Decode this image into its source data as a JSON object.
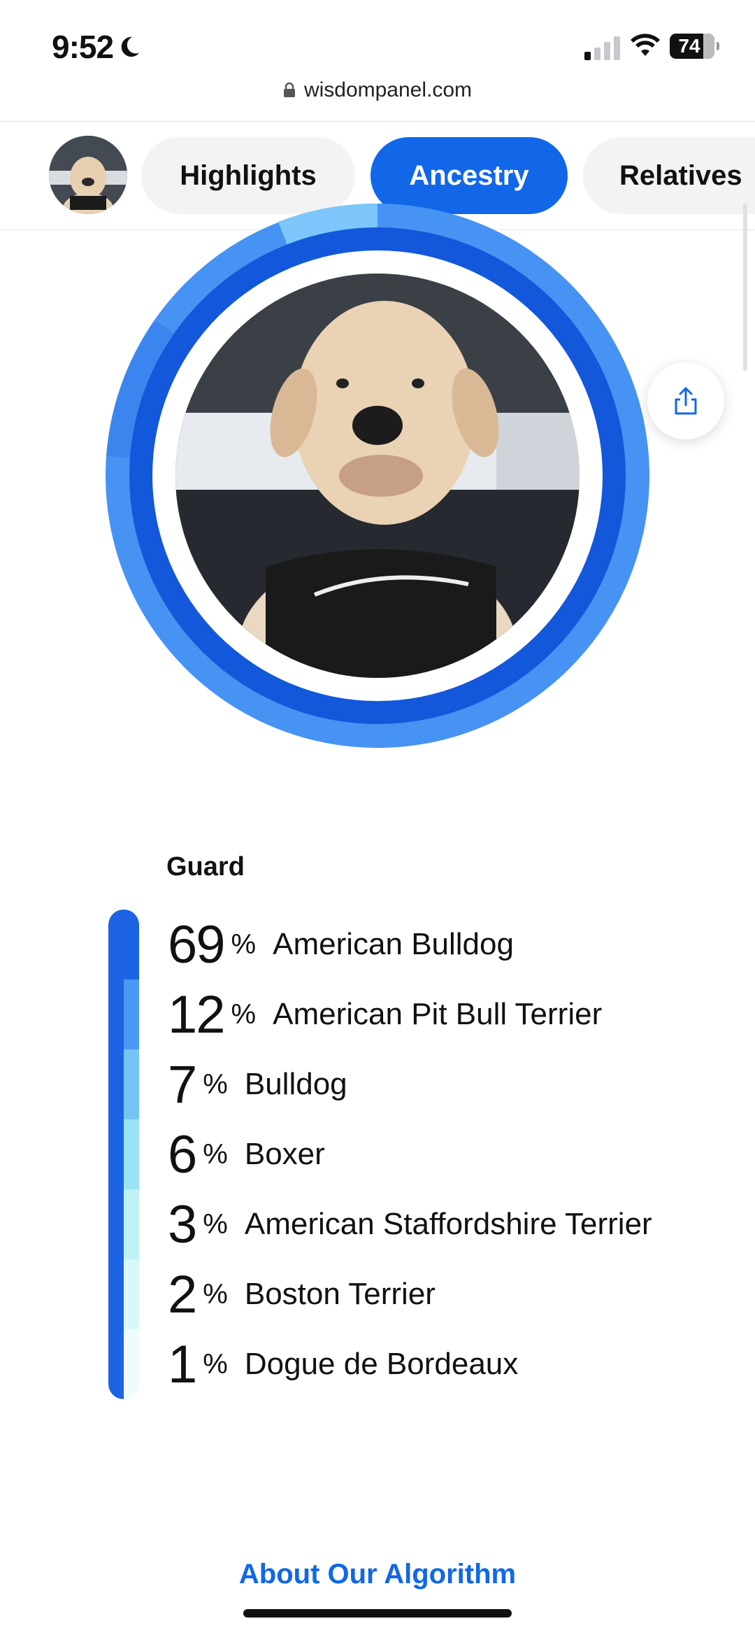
{
  "status_bar": {
    "time": "9:52",
    "battery": "74"
  },
  "browser": {
    "url": "wisdompanel.com"
  },
  "tabs": [
    {
      "label": "Highlights",
      "active": false
    },
    {
      "label": "Ancestry",
      "active": true
    },
    {
      "label": "Relatives",
      "active": false
    }
  ],
  "ancestry": {
    "group": "Guard",
    "breeds": [
      {
        "percent": "69",
        "name": "American Bulldog",
        "color": "#1c64e3"
      },
      {
        "percent": "12",
        "name": "American Pit Bull Terrier",
        "color": "#4b98f5"
      },
      {
        "percent": "7",
        "name": "Bulldog",
        "color": "#76c4f5"
      },
      {
        "percent": "6",
        "name": "Boxer",
        "color": "#9ae3f4"
      },
      {
        "percent": "3",
        "name": "American Staffordshire Terrier",
        "color": "#bff2f6"
      },
      {
        "percent": "2",
        "name": "Boston Terrier",
        "color": "#daf8fa"
      },
      {
        "percent": "1",
        "name": "Dogue de Bordeaux",
        "color": "#eefcfd"
      }
    ],
    "pct_symbol": "%"
  },
  "footer": {
    "about_link": "About Our Algorithm"
  },
  "colors": {
    "accent": "#1167e8",
    "ring_inner": "#1358db",
    "ring_outer": "#4693f3",
    "ring_light": "#7cc6fb"
  },
  "icons": [
    "moon-icon",
    "cellular-signal-icon",
    "wifi-icon",
    "battery-icon",
    "lock-icon",
    "share-icon"
  ]
}
